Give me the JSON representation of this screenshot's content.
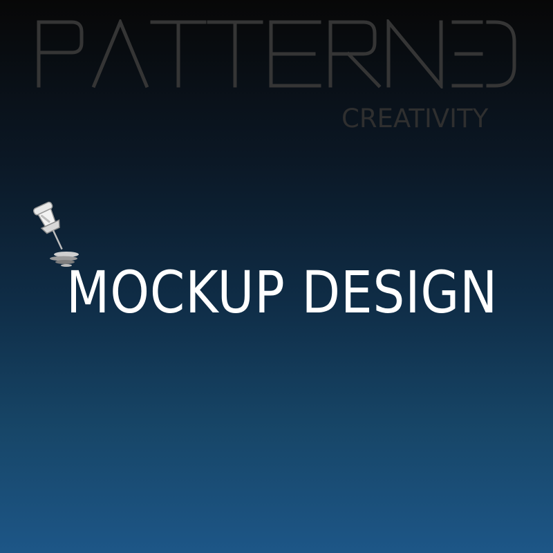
{
  "brand": {
    "name": "PATTERNED",
    "tagline": "CREATIVITY"
  },
  "title": "MOCKUP DESIGN",
  "icons": {
    "pin": "pushpin-icon"
  },
  "colors": {
    "background_top": "#070707",
    "background_bottom": "#1d5687",
    "logo": "#353535",
    "tagline": "#2f2f2f",
    "title": "#ffffff"
  }
}
